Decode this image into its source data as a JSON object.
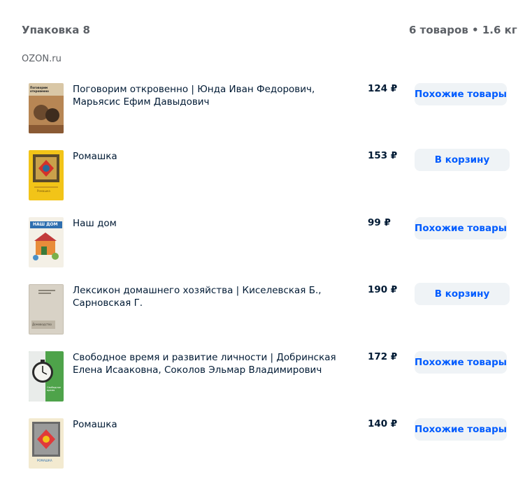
{
  "package": {
    "title": "Упаковка 8",
    "summary": "6 товаров • 1.6 кг",
    "seller": "OZON.ru"
  },
  "labels": {
    "similar": "Похожие товары",
    "cart": "В корзину"
  },
  "items": [
    {
      "name": "Поговорим откровенно | Юнда Иван Федорович, Марьясис Ефим Давыдович",
      "price": "124 ₽",
      "action": "Похожие товары",
      "cover_title": "Поговорим откровенно"
    },
    {
      "name": "Ромашка",
      "price": "153 ₽",
      "action": "В корзину",
      "cover_title": "Ромашка"
    },
    {
      "name": "Наш дом",
      "price": "99 ₽",
      "action": "Похожие товары",
      "cover_title": "НАШ ДОМ"
    },
    {
      "name": "Лексикон домашнего хозяйства | Киселевская Б., Сарновская Г.",
      "price": "190 ₽",
      "action": "В корзину",
      "cover_title": "Домоводство"
    },
    {
      "name": "Свободное время и развитие личности | Добринская Елена Исааковна, Соколов Эльмар Владимирович",
      "price": "172 ₽",
      "action": "Похожие товары",
      "cover_title": "Свободное время"
    },
    {
      "name": "Ромашка",
      "price": "140 ₽",
      "action": "Похожие товары",
      "cover_title": "РОМАШКА"
    }
  ]
}
